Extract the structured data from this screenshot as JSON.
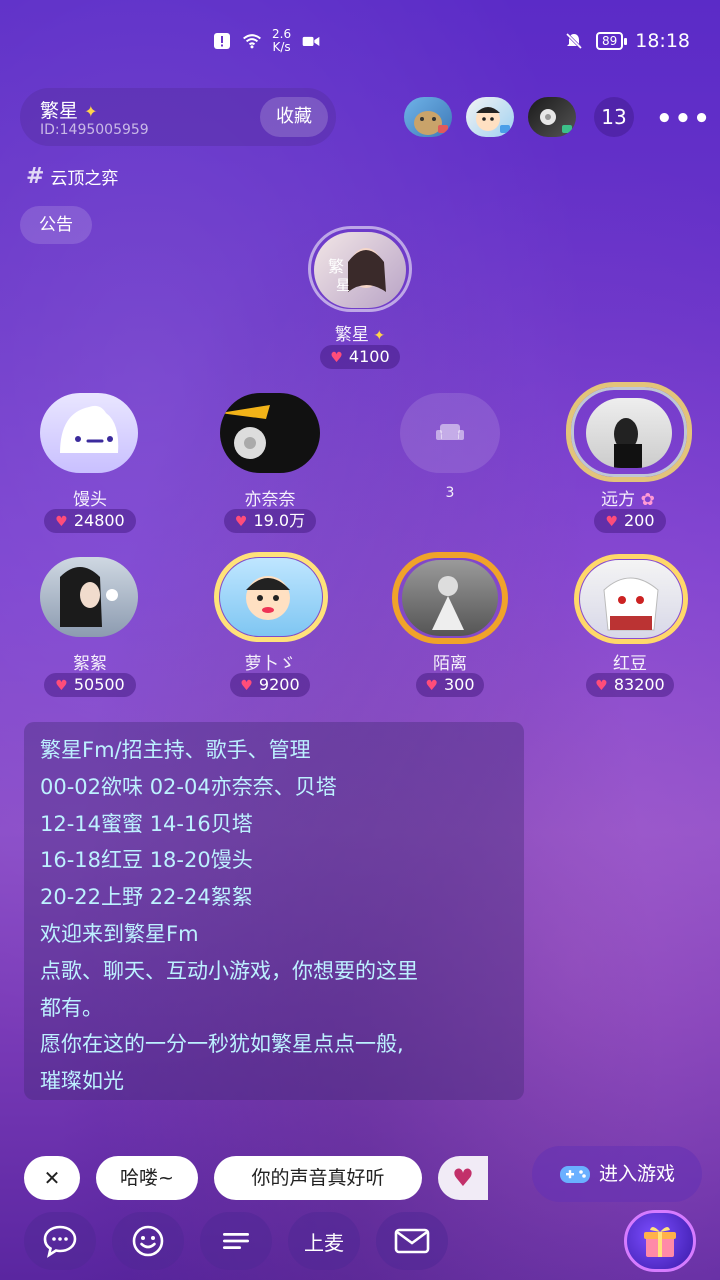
{
  "status_bar": {
    "net_speed_value": "2.6",
    "net_speed_unit": "K/s",
    "battery": "89",
    "time": "18:18"
  },
  "room": {
    "name": "繁星",
    "id": "ID:1495005959",
    "favorite_label": "收藏",
    "viewer_count": "13",
    "tag": "云顶之弈",
    "notice_label": "公告"
  },
  "host": {
    "name": "繁星",
    "score": "4100"
  },
  "seats_row1": [
    {
      "name": "馒头",
      "score": "24800"
    },
    {
      "name": "亦奈奈",
      "score": "19.0万"
    },
    {
      "name": "3",
      "score": ""
    },
    {
      "name": "远方",
      "score": "200"
    }
  ],
  "seats_row2": [
    {
      "name": "絮絮",
      "score": "50500"
    },
    {
      "name": "萝卜ゞ",
      "score": "9200"
    },
    {
      "name": "陌离",
      "score": "300"
    },
    {
      "name": "红豆",
      "score": "83200"
    }
  ],
  "announcement": [
    "繁星Fm/招主持、歌手、管理",
    "00-02欲味 02-04亦奈奈、贝塔",
    "12-14蜜蜜 14-16贝塔",
    "16-18红豆 18-20馒头",
    "20-22上野 22-24絮絮",
    "欢迎来到繁星Fm",
    "点歌、聊天、互动小游戏，你想要的这里",
    "都有。",
    "愿你在这的一分一秒犹如繁星点点一般,",
    "璀璨如光"
  ],
  "quick_chat": {
    "close_label": "✕",
    "items": [
      "哈喽~",
      "你的声音真好听"
    ]
  },
  "game_button_label": "进入游戏",
  "bottom_bar": {
    "mic_label": "上麦"
  },
  "colors": {
    "heart": "#ff4d7a",
    "announcement_text": "#bdf1ff",
    "accent": "#7b4dff"
  }
}
